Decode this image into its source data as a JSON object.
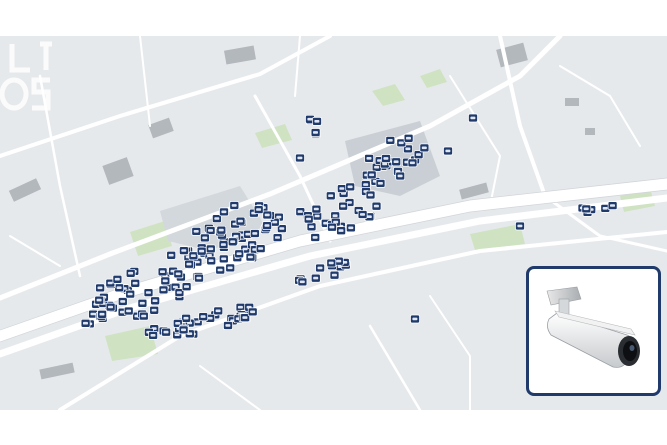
{
  "map": {
    "camera_marker_color": "#1f3a6b",
    "road_color": "#ffffff",
    "land_color": "#e6e9ec",
    "park_color": "#cfe3c2",
    "building_color": "#aeb3b8",
    "camera_clusters": [
      {
        "id": "west"
      },
      {
        "id": "central"
      },
      {
        "id": "north"
      },
      {
        "id": "south"
      },
      {
        "id": "east"
      }
    ]
  },
  "camera_card": {
    "icon": "bullet-security-camera-icon",
    "border_color": "#1f3a6b"
  },
  "watermark": {
    "icon": "channel-logo-watermark"
  }
}
